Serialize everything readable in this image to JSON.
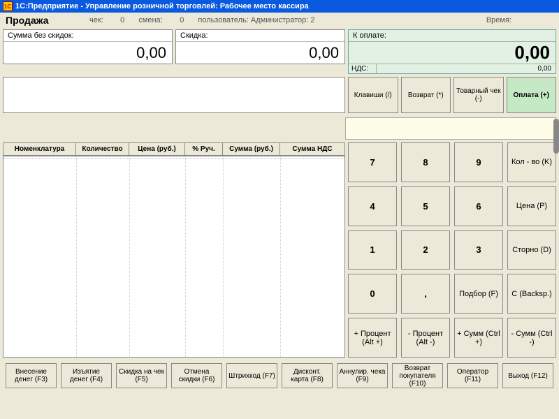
{
  "titlebar": {
    "app_name": "1С:Предприятие - Управление розничной торговлей: Рабочее место кассира",
    "icon_text": "1C"
  },
  "info": {
    "sale_label": "Продажа",
    "check_label": "чек:",
    "check_value": "0",
    "shift_label": "смена:",
    "shift_value": "0",
    "user_label": "пользователь:",
    "user_value": "Администратор: 2",
    "time_label": "Время:"
  },
  "panels": {
    "sum_no_discount_label": "Сумма без скидок:",
    "sum_no_discount_value": "0,00",
    "discount_label": "Скидка:",
    "discount_value": "0,00",
    "to_pay_label": "К оплате:",
    "to_pay_value": "0,00",
    "nds_label": "НДС:",
    "nds_value": "0,00"
  },
  "action_buttons": {
    "keys": "Клавиши (/)",
    "return": "Возврат (*)",
    "goods_check": "Товарный чек (-)",
    "pay": "Оплата (+)"
  },
  "table": {
    "headers": [
      "Номенклатура",
      "Количество",
      "Цена (руб.)",
      "% Руч.",
      "Сумма (руб.)",
      "Сумма НДС"
    ]
  },
  "keypad": [
    {
      "label": "7",
      "big": true
    },
    {
      "label": "8",
      "big": true
    },
    {
      "label": "9",
      "big": true
    },
    {
      "label": "Кол - во (K)"
    },
    {
      "label": "4",
      "big": true
    },
    {
      "label": "5",
      "big": true
    },
    {
      "label": "6",
      "big": true
    },
    {
      "label": "Цена (P)"
    },
    {
      "label": "1",
      "big": true
    },
    {
      "label": "2",
      "big": true
    },
    {
      "label": "3",
      "big": true
    },
    {
      "label": "Сторно (D)"
    },
    {
      "label": "0",
      "big": true
    },
    {
      "label": ",",
      "big": true
    },
    {
      "label": "Подбор (F)"
    },
    {
      "label": "C (Backsp.)"
    },
    {
      "label": "+ Процент (Alt +)"
    },
    {
      "label": "- Процент (Alt -)"
    },
    {
      "label": "+ Сумм (Ctrl +)"
    },
    {
      "label": "- Сумм (Ctrl -)"
    }
  ],
  "bottom_buttons": [
    "Внесение денег (F3)",
    "Изъятие денег (F4)",
    "Скидка на чек (F5)",
    "Отмена скидки (F6)",
    "Штрихкод (F7)",
    "Дисконт. карта (F8)",
    "Аннулир. чека (F9)",
    "Возврат покупателя (F10)",
    "Оператор (F11)",
    "Выход (F12)"
  ]
}
